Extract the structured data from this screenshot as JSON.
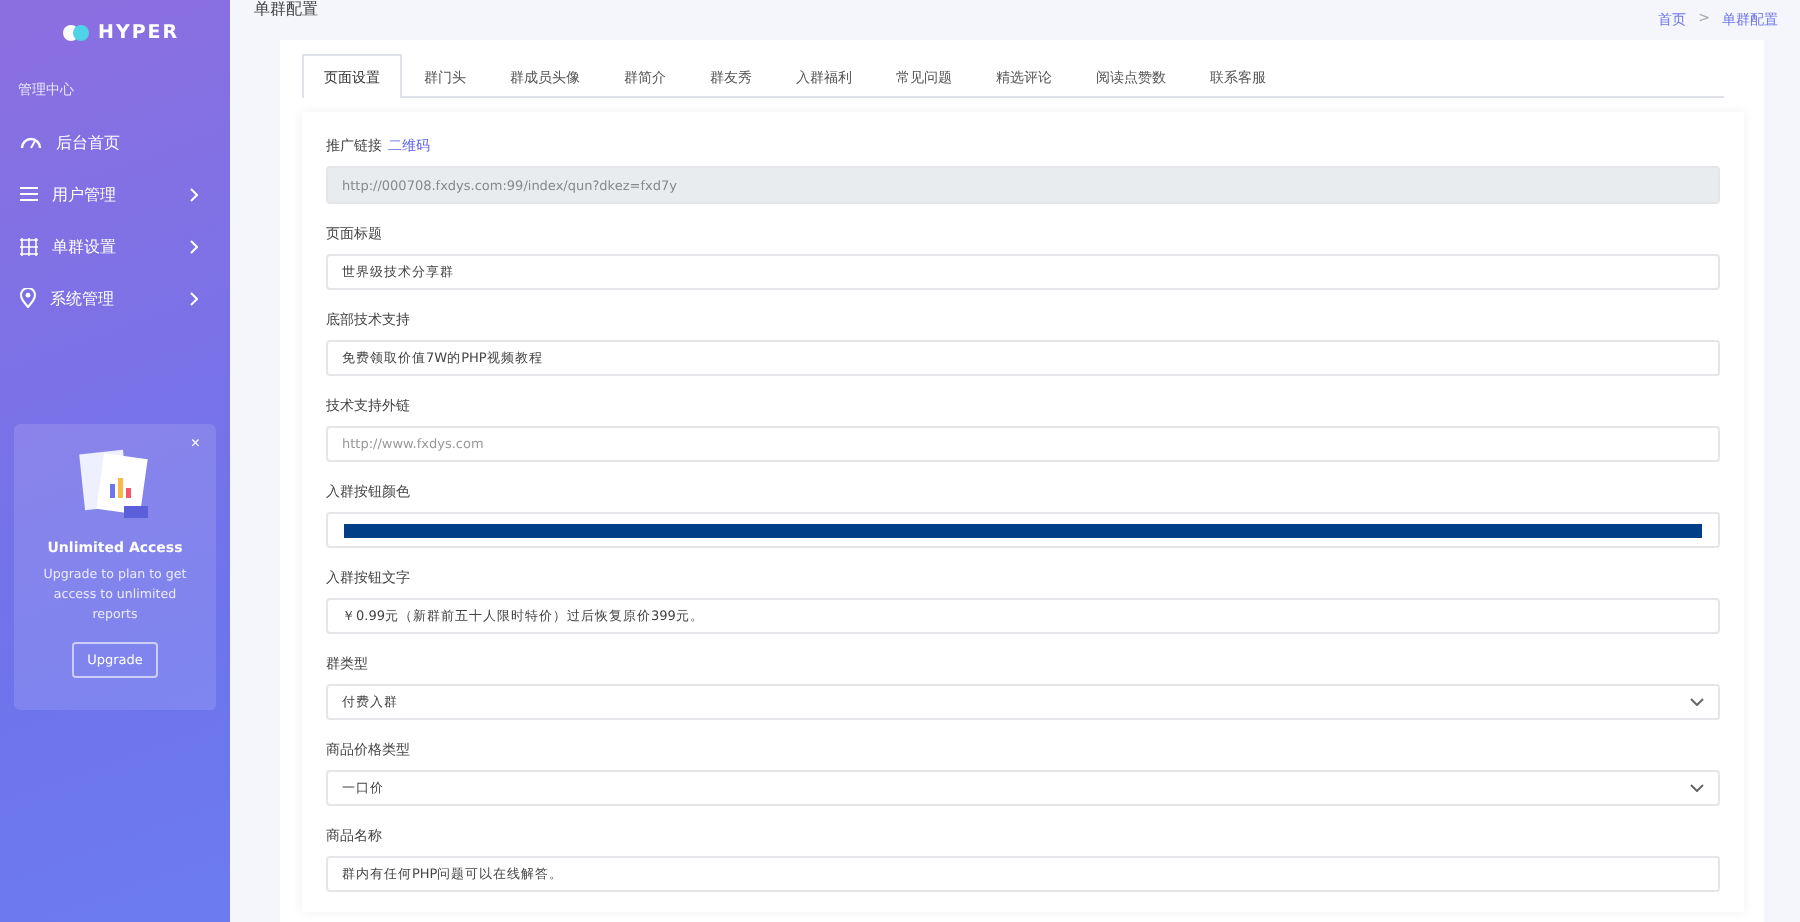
{
  "brand": {
    "name": "HYPER"
  },
  "sidebar": {
    "section": "管理中心",
    "items": [
      {
        "label": "后台首页",
        "has_children": false
      },
      {
        "label": "用户管理",
        "has_children": true
      },
      {
        "label": "单群设置",
        "has_children": true
      },
      {
        "label": "系统管理",
        "has_children": true
      }
    ],
    "promo": {
      "title": "Unlimited Access",
      "text": "Upgrade to plan to get access to unlimited reports",
      "button": "Upgrade",
      "close": "×"
    }
  },
  "page": {
    "title": "单群配置",
    "breadcrumb": [
      "首页",
      "单群配置"
    ],
    "breadcrumb_separator": ">"
  },
  "tabs": [
    {
      "label": "页面设置",
      "selected": true
    },
    {
      "label": "群门头",
      "selected": false
    },
    {
      "label": "群成员头像",
      "selected": false
    },
    {
      "label": "群简介",
      "selected": false
    },
    {
      "label": "群友秀",
      "selected": false
    },
    {
      "label": "入群福利",
      "selected": false
    },
    {
      "label": "常见问题",
      "selected": false
    },
    {
      "label": "精选评论",
      "selected": false
    },
    {
      "label": "阅读点赞数",
      "selected": false
    },
    {
      "label": "联系客服",
      "selected": false
    }
  ],
  "form": [
    {
      "kind": "readonly",
      "label": "推广链接",
      "link": "二维码",
      "value": "http://000708.fxdys.com:99/index/qun?dkez=fxd7y"
    },
    {
      "kind": "text",
      "label": "页面标题",
      "value": "世界级技术分享群"
    },
    {
      "kind": "text",
      "label": "底部技术支持",
      "value": "免费领取价值7W的PHP视频教程"
    },
    {
      "kind": "text",
      "label": "技术支持外链",
      "placeholder": "http://www.fxdys.com"
    },
    {
      "kind": "color",
      "label": "入群按钮颜色",
      "color": "#003f87"
    },
    {
      "kind": "text",
      "label": "入群按钮文字",
      "value": "￥0.99元（新群前五十人限时特价）过后恢复原价399元。"
    },
    {
      "kind": "select",
      "label": "群类型",
      "value": "付费入群"
    },
    {
      "kind": "select",
      "label": "商品价格类型",
      "value": "一口价"
    },
    {
      "kind": "text",
      "label": "商品名称",
      "value": "群内有任何PHP问题可以在线解答。"
    }
  ]
}
